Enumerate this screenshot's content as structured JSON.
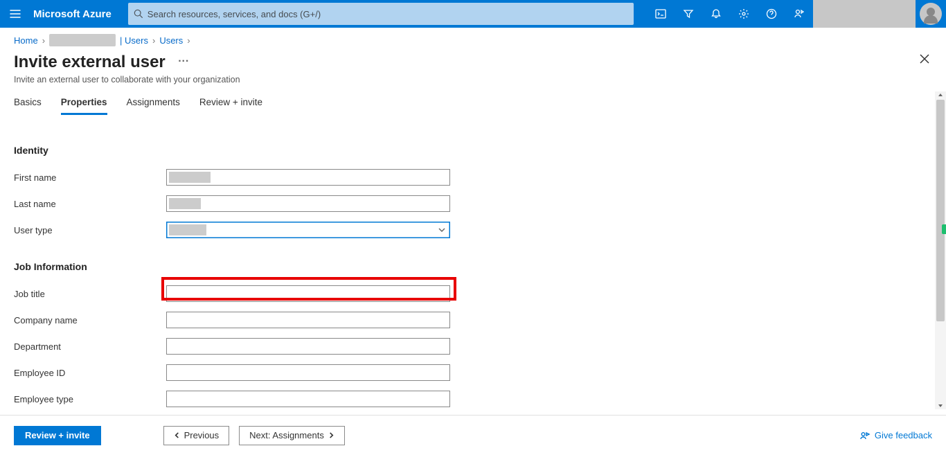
{
  "brand": "Microsoft Azure",
  "search": {
    "placeholder": "Search resources, services, and docs (G+/)"
  },
  "breadcrumbs": {
    "home": "Home",
    "users1": "| Users",
    "users2": "Users"
  },
  "page": {
    "title": "Invite external user",
    "subtitle": "Invite an external user to collaborate with your organization"
  },
  "tabs": {
    "basics": "Basics",
    "properties": "Properties",
    "assignments": "Assignments",
    "review": "Review + invite"
  },
  "sections": {
    "identity": "Identity",
    "job": "Job Information"
  },
  "fields": {
    "first_name": "First name",
    "last_name": "Last name",
    "user_type": "User type",
    "job_title": "Job title",
    "company_name": "Company name",
    "department": "Department",
    "employee_id": "Employee ID",
    "employee_type": "Employee type"
  },
  "footer": {
    "review": "Review + invite",
    "previous": "Previous",
    "next": "Next: Assignments",
    "feedback": "Give feedback"
  }
}
